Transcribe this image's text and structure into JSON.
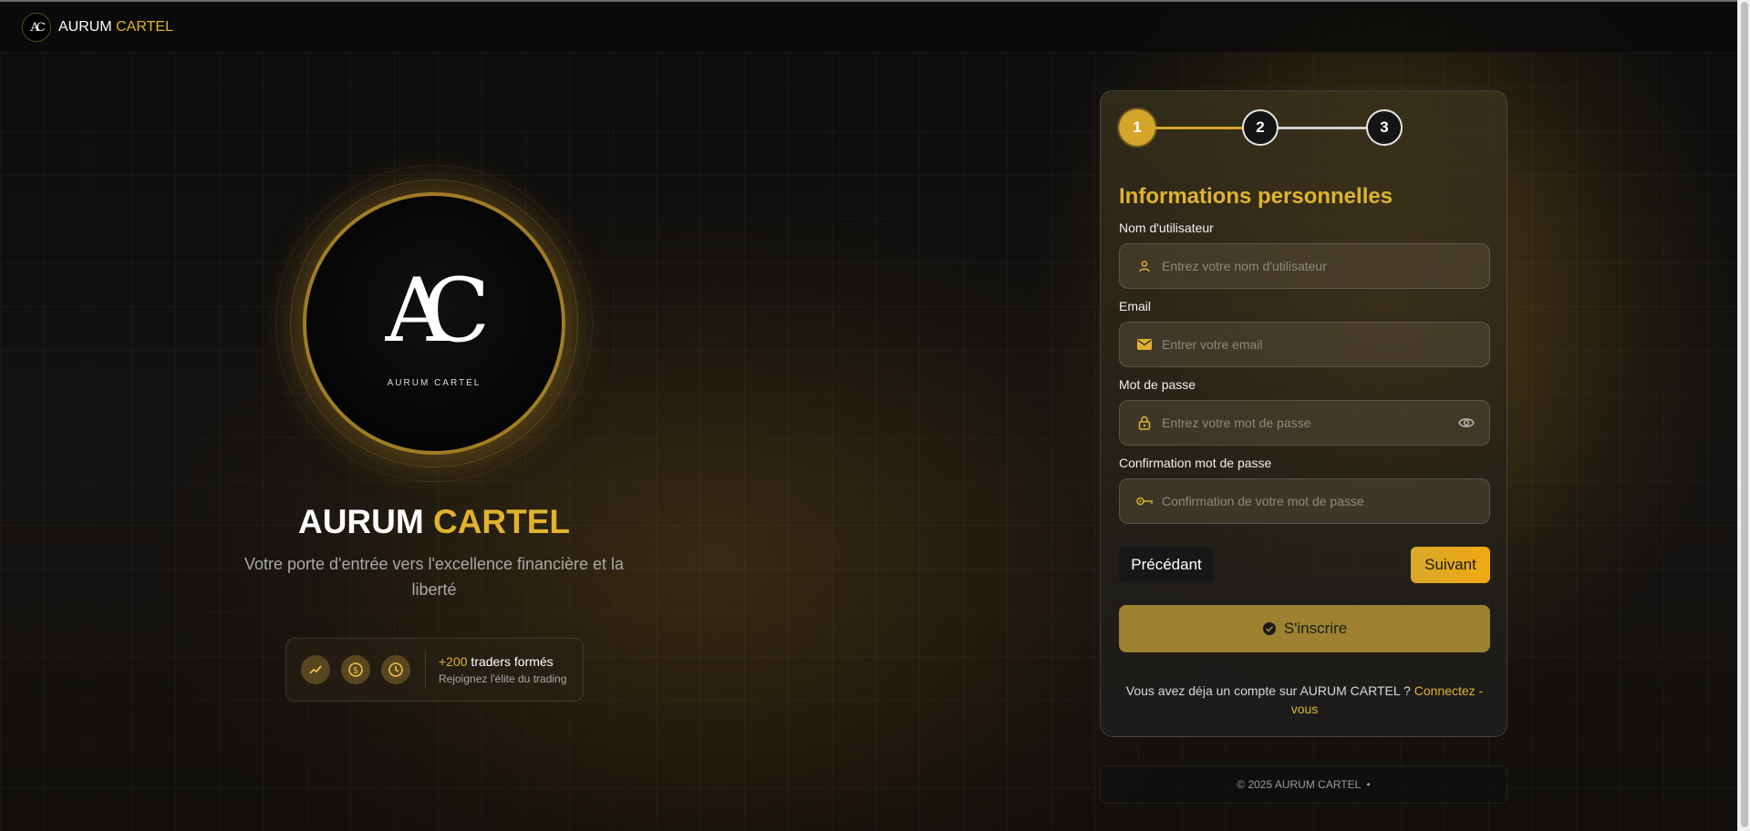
{
  "header": {
    "brand_first": "AURUM",
    "brand_second": "CARTEL"
  },
  "hero": {
    "monogram": "AC",
    "logo_subtitle": "AURUM   CARTEL",
    "title_first": "AURUM",
    "title_second": "CARTEL",
    "subtitle": "Votre porte d'entrée vers l'excellence financière et la liberté",
    "stats": {
      "icons": [
        "trending-up-icon",
        "dollar-coin-icon",
        "clock-icon"
      ],
      "count": "+200",
      "count_label": " traders formés",
      "tagline": "Rejoignez l'élite du trading"
    }
  },
  "form": {
    "steps": [
      "1",
      "2",
      "3"
    ],
    "active_step": 1,
    "section_title": "Informations personnelles",
    "fields": {
      "username": {
        "label": "Nom d'utilisateur",
        "placeholder": "Entrez votre nom d'utilisateur",
        "icon": "user-icon"
      },
      "email": {
        "label": "Email",
        "placeholder": "Entrer votre email",
        "icon": "envelope-icon"
      },
      "password": {
        "label": "Mot de passe",
        "placeholder": "Entrez votre mot de passe",
        "icon": "lock-icon"
      },
      "confirm": {
        "label": "Confirmation mot de passe",
        "placeholder": "Confirmation de votre mot de passe",
        "icon": "key-icon"
      }
    },
    "prev_label": "Précédant",
    "next_label": "Suivant",
    "signup_label": "S'inscrire",
    "login_text": "Vous avez déja un compte sur AURUM CARTEL ? ",
    "login_link": "Connectez - vous"
  },
  "footer": {
    "text": "© 2025 AURUM CARTEL  •"
  },
  "colors": {
    "accent": "#e0b32e",
    "background": "#111111",
    "signup_button": "#9d8131"
  }
}
